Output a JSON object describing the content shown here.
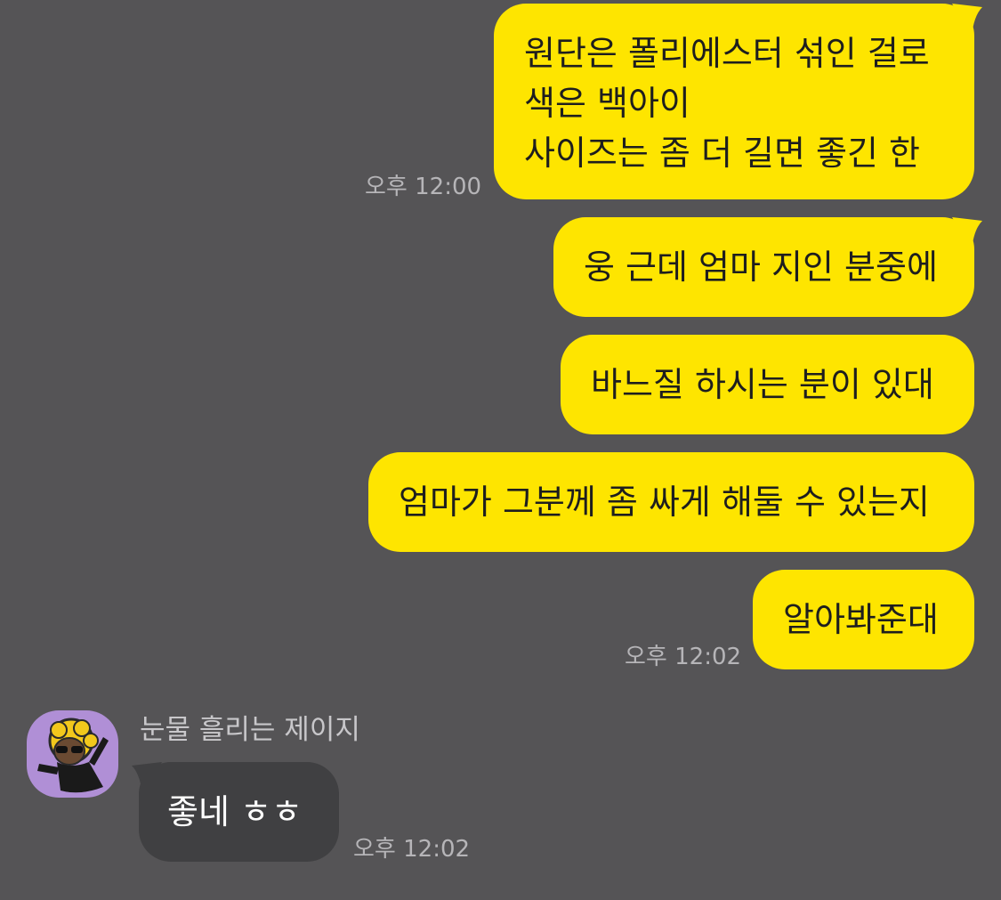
{
  "messages_sent": [
    {
      "lines": [
        "원단은 폴리에스터 섞인 걸로",
        "색은 백아이",
        "사이즈는 좀 더 길면 좋긴 한"
      ],
      "time": "오후 12:00"
    },
    {
      "lines": [
        "웅 근데 엄마 지인 분중에"
      ]
    },
    {
      "lines": [
        "바느질 하시는 분이 있대"
      ]
    },
    {
      "lines": [
        "엄마가 그분께 좀 싸게 해둘 수 있는지"
      ]
    },
    {
      "lines": [
        "알아봐준대"
      ],
      "time": "오후 12:02"
    }
  ],
  "message_received": {
    "sender_name": "눈물 흘리는 제이지",
    "avatar_icon": "jay-g-character-icon",
    "text": "좋네 ㅎㅎ",
    "time": "오후 12:02"
  },
  "colors": {
    "background": "#555456",
    "sent_bubble": "#fee500",
    "received_bubble": "#404042",
    "avatar_bg": "#b08fd6"
  }
}
